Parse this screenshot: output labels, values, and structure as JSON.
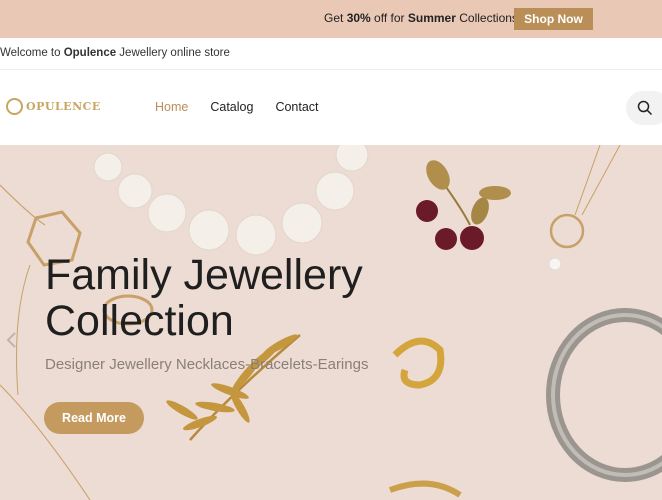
{
  "promo": {
    "text_prefix": "Get ",
    "text_bold1": "30%",
    "text_mid": " off for ",
    "text_bold2": "Summer",
    "text_suffix": " Collections",
    "button_label": "Shop Now"
  },
  "welcome": {
    "prefix": "Welcome to ",
    "brand": "Opulence",
    "suffix": " Jewellery online store"
  },
  "header": {
    "logo_text": "OPULENCE",
    "nav": [
      "Home",
      "Catalog",
      "Contact"
    ],
    "active_nav": "Home"
  },
  "hero": {
    "title_line1": "Family Jewellery",
    "title_line2": "Collection",
    "subtitle": "Designer Jewellery Necklaces-Bracelets-Earings",
    "button_label": "Read More"
  },
  "colors": {
    "promo_bg": "#e9c9b5",
    "accent": "#b98f57",
    "hero_bg": "#ecdcd3"
  },
  "icons": {
    "search": "search-icon",
    "prev": "chevron-left-icon"
  }
}
